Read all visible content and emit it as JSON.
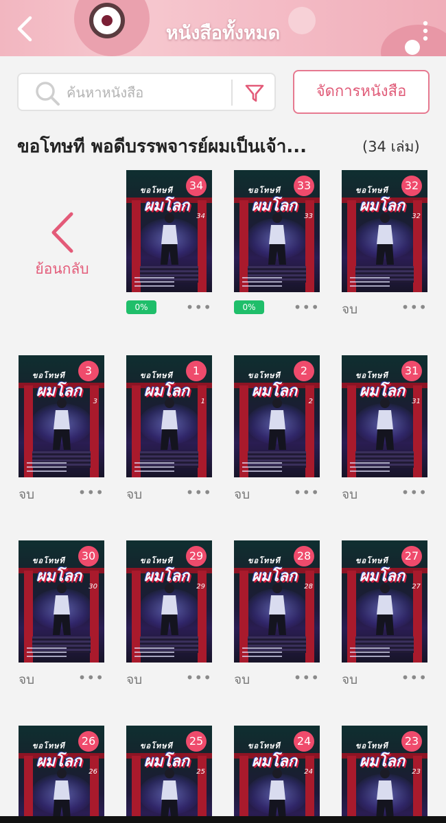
{
  "header": {
    "title": "หนังสือทั้งหมด",
    "back_icon": "chevron-left-icon",
    "menu_icon": "more-vertical-icon"
  },
  "search": {
    "placeholder": "ค้นหาหนังสือ",
    "value": "",
    "search_icon": "search-icon",
    "filter_icon": "filter-icon"
  },
  "manage_button": {
    "label": "จัดการหนังสือ"
  },
  "series": {
    "title": "ขอโทษที พอดีบรรพจารย์ผมเป็นเจ้า...",
    "count": "(34 เล่ม)"
  },
  "back_tile": {
    "label": "ย้อนกลับ"
  },
  "colors": {
    "accent": "#e35a78",
    "badge": "#ef4b6c",
    "progress": "#1fbe6a"
  },
  "cover": {
    "logo_top": "ขอโทษที",
    "logo_big": "ผมโลก"
  },
  "books": [
    {
      "volume": "34",
      "status": "",
      "progress": "0%"
    },
    {
      "volume": "33",
      "status": "",
      "progress": "0%"
    },
    {
      "volume": "32",
      "status": "จบ",
      "progress": ""
    },
    {
      "volume": "3",
      "status": "จบ",
      "progress": ""
    },
    {
      "volume": "1",
      "status": "จบ",
      "progress": ""
    },
    {
      "volume": "2",
      "status": "จบ",
      "progress": ""
    },
    {
      "volume": "31",
      "status": "จบ",
      "progress": ""
    },
    {
      "volume": "30",
      "status": "จบ",
      "progress": ""
    },
    {
      "volume": "29",
      "status": "จบ",
      "progress": ""
    },
    {
      "volume": "28",
      "status": "จบ",
      "progress": ""
    },
    {
      "volume": "27",
      "status": "จบ",
      "progress": ""
    },
    {
      "volume": "26",
      "status": "",
      "progress": ""
    },
    {
      "volume": "25",
      "status": "",
      "progress": ""
    },
    {
      "volume": "24",
      "status": "",
      "progress": ""
    },
    {
      "volume": "23",
      "status": "",
      "progress": ""
    }
  ]
}
